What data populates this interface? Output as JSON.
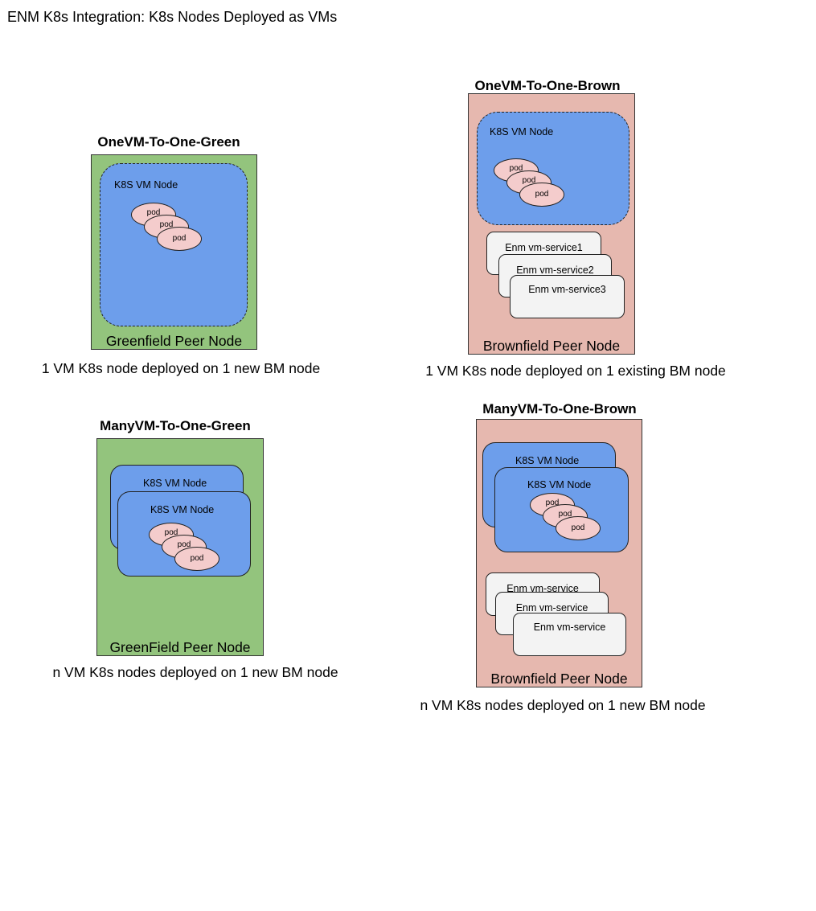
{
  "title": "ENM K8s Integration: K8s Nodes Deployed as VMs",
  "scenarios": {
    "one_green": {
      "title": "OneVM-To-One-Green",
      "vm_label": "K8S VM Node",
      "pod_label": "pod",
      "peer_label": "Greenfield Peer Node",
      "caption": "1 VM K8s node deployed on 1 new BM node"
    },
    "one_brown": {
      "title": "OneVM-To-One-Brown",
      "vm_label": "K8S VM Node",
      "pod_label": "pod",
      "services": [
        "Enm vm-service1",
        "Enm vm-service2",
        "Enm vm-service3"
      ],
      "peer_label": "Brownfield Peer Node",
      "caption": "1 VM K8s node deployed on 1 existing BM node"
    },
    "many_green": {
      "title": "ManyVM-To-One-Green",
      "vm_labels": [
        "K8S VM Node",
        "K8S VM Node"
      ],
      "pod_label": "pod",
      "peer_label": "GreenField Peer Node",
      "caption": "n VM K8s nodes  deployed on 1 new BM node"
    },
    "many_brown": {
      "title": "ManyVM-To-One-Brown",
      "vm_labels": [
        "K8S VM Node",
        "K8S VM Node"
      ],
      "pod_label": "pod",
      "services": [
        "Enm vm-service",
        "Enm vm-service",
        "Enm vm-service"
      ],
      "peer_label": "Brownfield Peer Node",
      "caption": "n VM K8s nodes deployed on 1 new BM node"
    }
  }
}
